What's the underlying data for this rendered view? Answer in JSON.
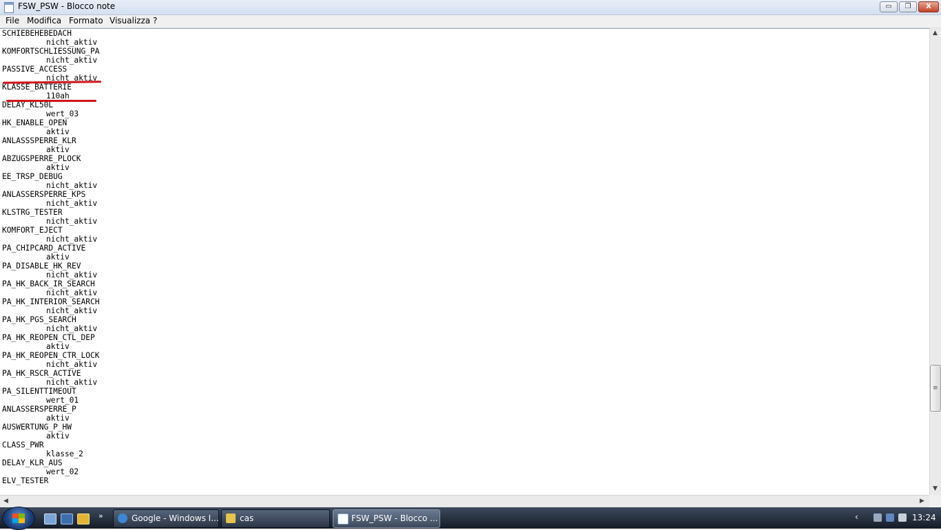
{
  "window": {
    "title": "FSW_PSW - Blocco note",
    "minimize": "▭",
    "maximize": "❐",
    "close": "X"
  },
  "menu": [
    "File",
    "Modifica",
    "Formato",
    "Visualizza",
    "?"
  ],
  "editor_lines": [
    {
      "text": "SCHIEBEHEBEDACH",
      "indent": false
    },
    {
      "text": "nicht_aktiv",
      "indent": true
    },
    {
      "text": "KOMFORTSCHLIESSUNG_PA",
      "indent": false
    },
    {
      "text": "nicht_aktiv",
      "indent": true
    },
    {
      "text": "PASSIVE_ACCESS",
      "indent": false
    },
    {
      "text": "nicht_aktiv",
      "indent": true
    },
    {
      "text": "KLASSE_BATTERIE",
      "indent": false
    },
    {
      "text": "110ah",
      "indent": true
    },
    {
      "text": "DELAY_KL50L",
      "indent": false
    },
    {
      "text": "wert_03",
      "indent": true
    },
    {
      "text": "HK_ENABLE_OPEN",
      "indent": false
    },
    {
      "text": "aktiv",
      "indent": true
    },
    {
      "text": "ANLASSSPERRE_KLR",
      "indent": false
    },
    {
      "text": "aktiv",
      "indent": true
    },
    {
      "text": "ABZUGSPERRE_PLOCK",
      "indent": false
    },
    {
      "text": "aktiv",
      "indent": true
    },
    {
      "text": "EE_TRSP_DEBUG",
      "indent": false
    },
    {
      "text": "nicht_aktiv",
      "indent": true
    },
    {
      "text": "ANLASSERSPERRE_KPS",
      "indent": false
    },
    {
      "text": "nicht_aktiv",
      "indent": true
    },
    {
      "text": "KLSTRG_TESTER",
      "indent": false
    },
    {
      "text": "nicht_aktiv",
      "indent": true
    },
    {
      "text": "KOMFORT_EJECT",
      "indent": false
    },
    {
      "text": "nicht_aktiv",
      "indent": true
    },
    {
      "text": "PA_CHIPCARD_ACTIVE",
      "indent": false
    },
    {
      "text": "aktiv",
      "indent": true
    },
    {
      "text": "PA_DISABLE_HK_REV",
      "indent": false
    },
    {
      "text": "nicht_aktiv",
      "indent": true
    },
    {
      "text": "PA_HK_BACK_IR_SEARCH",
      "indent": false
    },
    {
      "text": "nicht_aktiv",
      "indent": true
    },
    {
      "text": "PA_HK_INTERIOR_SEARCH",
      "indent": false
    },
    {
      "text": "nicht_aktiv",
      "indent": true
    },
    {
      "text": "PA_HK_PGS_SEARCH",
      "indent": false
    },
    {
      "text": "nicht_aktiv",
      "indent": true
    },
    {
      "text": "PA_HK_REOPEN_CTL_DEP",
      "indent": false
    },
    {
      "text": "aktiv",
      "indent": true
    },
    {
      "text": "PA_HK_REOPEN_CTR_LOCK",
      "indent": false
    },
    {
      "text": "nicht_aktiv",
      "indent": true
    },
    {
      "text": "PA_HK_RSCR_ACTIVE",
      "indent": false
    },
    {
      "text": "nicht_aktiv",
      "indent": true
    },
    {
      "text": "PA_SILENTTIMEOUT",
      "indent": false
    },
    {
      "text": "wert_01",
      "indent": true
    },
    {
      "text": "ANLASSERSPERRE_P",
      "indent": false
    },
    {
      "text": "aktiv",
      "indent": true
    },
    {
      "text": "AUSWERTUNG_P_HW",
      "indent": false
    },
    {
      "text": "aktiv",
      "indent": true
    },
    {
      "text": "CLASS_PWR",
      "indent": false
    },
    {
      "text": "klasse_2",
      "indent": true
    },
    {
      "text": "DELAY_KLR_AUS",
      "indent": false
    },
    {
      "text": "wert_02",
      "indent": true
    },
    {
      "text": "ELV_TESTER",
      "indent": false
    }
  ],
  "scrollbar": {
    "vertical_position": 0.82
  },
  "taskbar": {
    "tasks": [
      {
        "label": "Google - Windows I...",
        "icon": "internet-explorer-icon",
        "active": false
      },
      {
        "label": "cas",
        "icon": "folder-icon",
        "active": false
      },
      {
        "label": "FSW_PSW - Blocco ...",
        "icon": "notepad-icon",
        "active": true
      }
    ],
    "quicklaunch_more": "»",
    "tray_arrow": "‹",
    "clock": "13:24"
  },
  "colors": {
    "annotation": "#d0141a",
    "taskbar": "#1c2431"
  }
}
